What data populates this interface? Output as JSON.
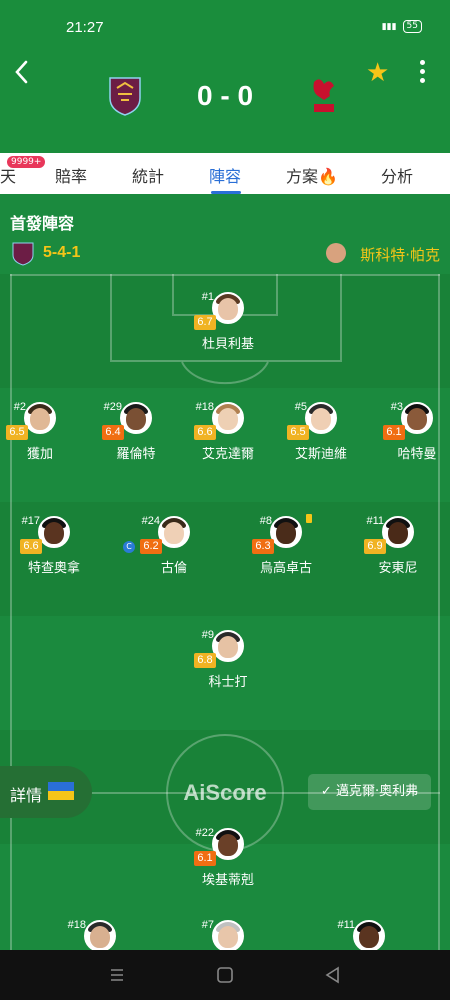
{
  "status": {
    "time": "21:27",
    "battery": "55",
    "network": "4G"
  },
  "match": {
    "score": "0 - 0",
    "home_team": "Burnley",
    "away_team": "Liverpool"
  },
  "tabs": [
    {
      "label": "天"
    },
    {
      "label": "賠率"
    },
    {
      "label": "統計"
    },
    {
      "label": "陣容"
    },
    {
      "label": "方案"
    },
    {
      "label": "分析"
    }
  ],
  "badge": "9999+",
  "lineup": {
    "title": "首發陣容",
    "formation": "5-4-1",
    "coach": "斯科特·帕克"
  },
  "players": [
    {
      "number": "#1",
      "name": "杜貝利基",
      "rating": "6.7",
      "rating_color": "yellow"
    },
    {
      "number": "#2",
      "name": "獲加",
      "rating": "6.5",
      "rating_color": "yellow"
    },
    {
      "number": "#29",
      "name": "羅倫特",
      "rating": "6.4",
      "rating_color": "orange"
    },
    {
      "number": "#18",
      "name": "艾克達爾",
      "rating": "6.6",
      "rating_color": "yellow"
    },
    {
      "number": "#5",
      "name": "艾斯迪維",
      "rating": "6.5",
      "rating_color": "yellow"
    },
    {
      "number": "#3",
      "name": "哈特曼",
      "rating": "6.1",
      "rating_color": "orange"
    },
    {
      "number": "#17",
      "name": "特查奧拿",
      "rating": "6.6",
      "rating_color": "yellow"
    },
    {
      "number": "#24",
      "name": "古倫",
      "rating": "6.2",
      "rating_color": "orange",
      "captain": "C"
    },
    {
      "number": "#8",
      "name": "烏高卓古",
      "rating": "6.3",
      "rating_color": "orange"
    },
    {
      "number": "#11",
      "name": "安東尼",
      "rating": "6.9",
      "rating_color": "yellow"
    },
    {
      "number": "#9",
      "name": "科士打",
      "rating": "6.8",
      "rating_color": "yellow"
    },
    {
      "number": "#22",
      "name": "埃基蒂剋",
      "rating": "6.1",
      "rating_color": "orange"
    },
    {
      "number": "#18",
      "name": "",
      "rating": "",
      "rating_color": ""
    },
    {
      "number": "#7",
      "name": "",
      "rating": "",
      "rating_color": ""
    },
    {
      "number": "#11",
      "name": "",
      "rating": "",
      "rating_color": ""
    }
  ],
  "details_label": "詳情",
  "watermark": "AiScore",
  "referee": "邁克爾·奧利弗",
  "colors": {
    "header": "#1a8d3c",
    "pitch": "#1b8a3e",
    "accent": "#2a6fd6",
    "rating_yellow": "#f0b323",
    "rating_orange": "#f06e12"
  }
}
